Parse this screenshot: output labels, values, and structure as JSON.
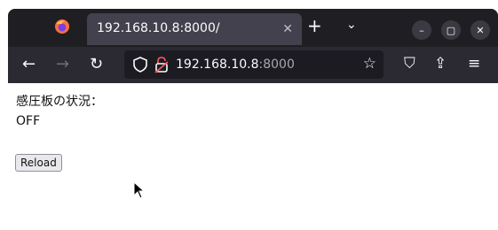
{
  "browser": {
    "tab": {
      "title": "192.168.10.8:8000/",
      "close_glyph": "✕"
    },
    "new_tab_glyph": "+",
    "list_tabs_glyph": "⌄",
    "window_controls": {
      "minimize": "–",
      "maximize": "▢",
      "close": "✕"
    },
    "nav": {
      "back": "←",
      "forward": "→",
      "reload": "↻"
    },
    "url": {
      "host": "192.168.10.8",
      "port": ":8000"
    },
    "bookmark_glyph": "☆",
    "tools": {
      "pocket": "⛉",
      "extensions": "⇪",
      "menu": "≡"
    }
  },
  "page": {
    "status_label": "感圧板の状況：",
    "status_value": "OFF",
    "reload_button": "Reload"
  }
}
